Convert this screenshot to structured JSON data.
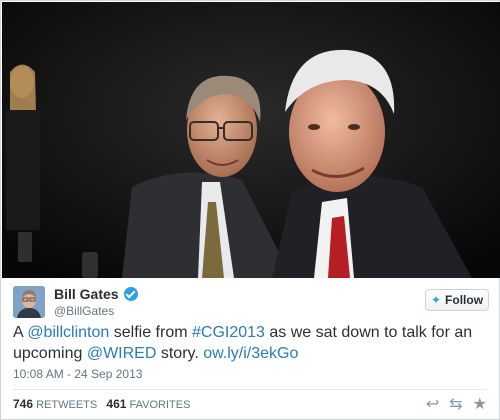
{
  "author": {
    "name": "Bill Gates",
    "handle": "@BillGates"
  },
  "follow_button": {
    "label": "Follow"
  },
  "tweet": {
    "parts": {
      "t1": "A ",
      "mention1": "@billclinton",
      "t2": " selfie from ",
      "hashtag": "#CGI2013",
      "t3": " as we sat down to talk for an upcoming ",
      "mention2": "@WIRED",
      "t4": " story. ",
      "link": "ow.ly/i/3ekGo"
    },
    "timestamp": "10:08 AM - 24 Sep 2013"
  },
  "stats": {
    "retweets_count": "746",
    "retweets_label": "RETWEETS",
    "favorites_count": "461",
    "favorites_label": "FAVORITES"
  },
  "icons": {
    "reply": "reply-icon",
    "retweet": "retweet-icon",
    "favorite": "star-icon",
    "verified": "verified-badge-icon",
    "follow_bird": "twitter-bird-icon"
  },
  "colors": {
    "link": "#2b7bb9",
    "verified": "#2ea0e6",
    "muted": "#66757f"
  }
}
